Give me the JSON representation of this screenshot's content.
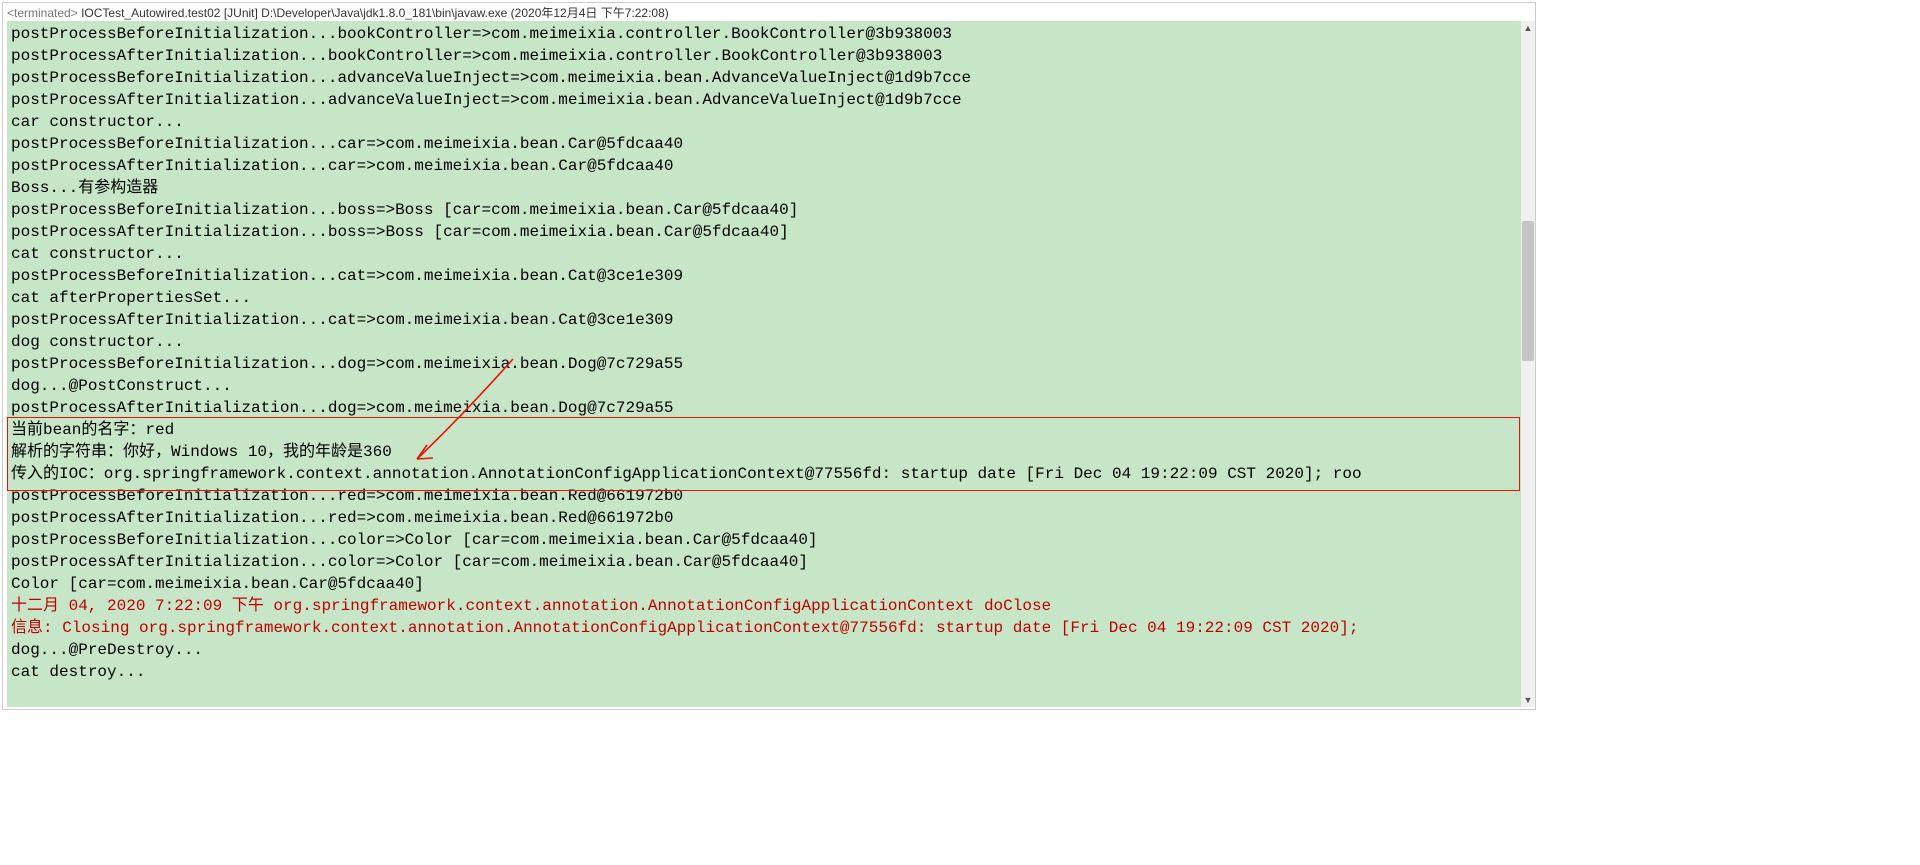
{
  "header": {
    "state": "<terminated>",
    "test": "IOCTest_Autowired.test02",
    "suite": "[JUnit]",
    "path": "D:\\Developer\\Java\\jdk1.8.0_181\\bin\\javaw.exe",
    "time": "(2020年12月4日 下午7:22:08)"
  },
  "console_lines": [
    {
      "t": "postProcessBeforeInitialization...bookController=>com.meimeixia.controller.BookController@3b938003"
    },
    {
      "t": "postProcessAfterInitialization...bookController=>com.meimeixia.controller.BookController@3b938003"
    },
    {
      "t": "postProcessBeforeInitialization...advanceValueInject=>com.meimeixia.bean.AdvanceValueInject@1d9b7cce"
    },
    {
      "t": "postProcessAfterInitialization...advanceValueInject=>com.meimeixia.bean.AdvanceValueInject@1d9b7cce"
    },
    {
      "t": "car constructor..."
    },
    {
      "t": "postProcessBeforeInitialization...car=>com.meimeixia.bean.Car@5fdcaa40"
    },
    {
      "t": "postProcessAfterInitialization...car=>com.meimeixia.bean.Car@5fdcaa40"
    },
    {
      "t": "Boss...有参构造器"
    },
    {
      "t": "postProcessBeforeInitialization...boss=>Boss [car=com.meimeixia.bean.Car@5fdcaa40]"
    },
    {
      "t": "postProcessAfterInitialization...boss=>Boss [car=com.meimeixia.bean.Car@5fdcaa40]"
    },
    {
      "t": "cat constructor..."
    },
    {
      "t": "postProcessBeforeInitialization...cat=>com.meimeixia.bean.Cat@3ce1e309"
    },
    {
      "t": "cat afterPropertiesSet..."
    },
    {
      "t": "postProcessAfterInitialization...cat=>com.meimeixia.bean.Cat@3ce1e309"
    },
    {
      "t": "dog constructor..."
    },
    {
      "t": "postProcessBeforeInitialization...dog=>com.meimeixia.bean.Dog@7c729a55"
    },
    {
      "t": "dog...@PostConstruct..."
    },
    {
      "t": "postProcessAfterInitialization...dog=>com.meimeixia.bean.Dog@7c729a55"
    },
    {
      "t": "当前bean的名字：red"
    },
    {
      "t": "解析的字符串：你好，Windows 10，我的年龄是360"
    },
    {
      "t": "传入的IOC：org.springframework.context.annotation.AnnotationConfigApplicationContext@77556fd: startup date [Fri Dec 04 19:22:09 CST 2020]; roo"
    },
    {
      "t": "postProcessBeforeInitialization...red=>com.meimeixia.bean.Red@661972b0"
    },
    {
      "t": "postProcessAfterInitialization...red=>com.meimeixia.bean.Red@661972b0"
    },
    {
      "t": "postProcessBeforeInitialization...color=>Color [car=com.meimeixia.bean.Car@5fdcaa40]"
    },
    {
      "t": "postProcessAfterInitialization...color=>Color [car=com.meimeixia.bean.Car@5fdcaa40]"
    },
    {
      "t": "Color [car=com.meimeixia.bean.Car@5fdcaa40]"
    },
    {
      "t": "十二月 04, 2020 7:22:09 下午 org.springframework.context.annotation.AnnotationConfigApplicationContext doClose",
      "cls": "red-text"
    },
    {
      "t": "信息: Closing org.springframework.context.annotation.AnnotationConfigApplicationContext@77556fd: startup date [Fri Dec 04 19:22:09 CST 2020];",
      "cls": "red-text"
    },
    {
      "t": "dog...@PreDestroy..."
    },
    {
      "t": "cat destroy..."
    }
  ],
  "highlight_box": {
    "top_line_index": 18,
    "height_lines": 3
  },
  "scroll_icons": {
    "up": "▲",
    "down": "▼"
  }
}
